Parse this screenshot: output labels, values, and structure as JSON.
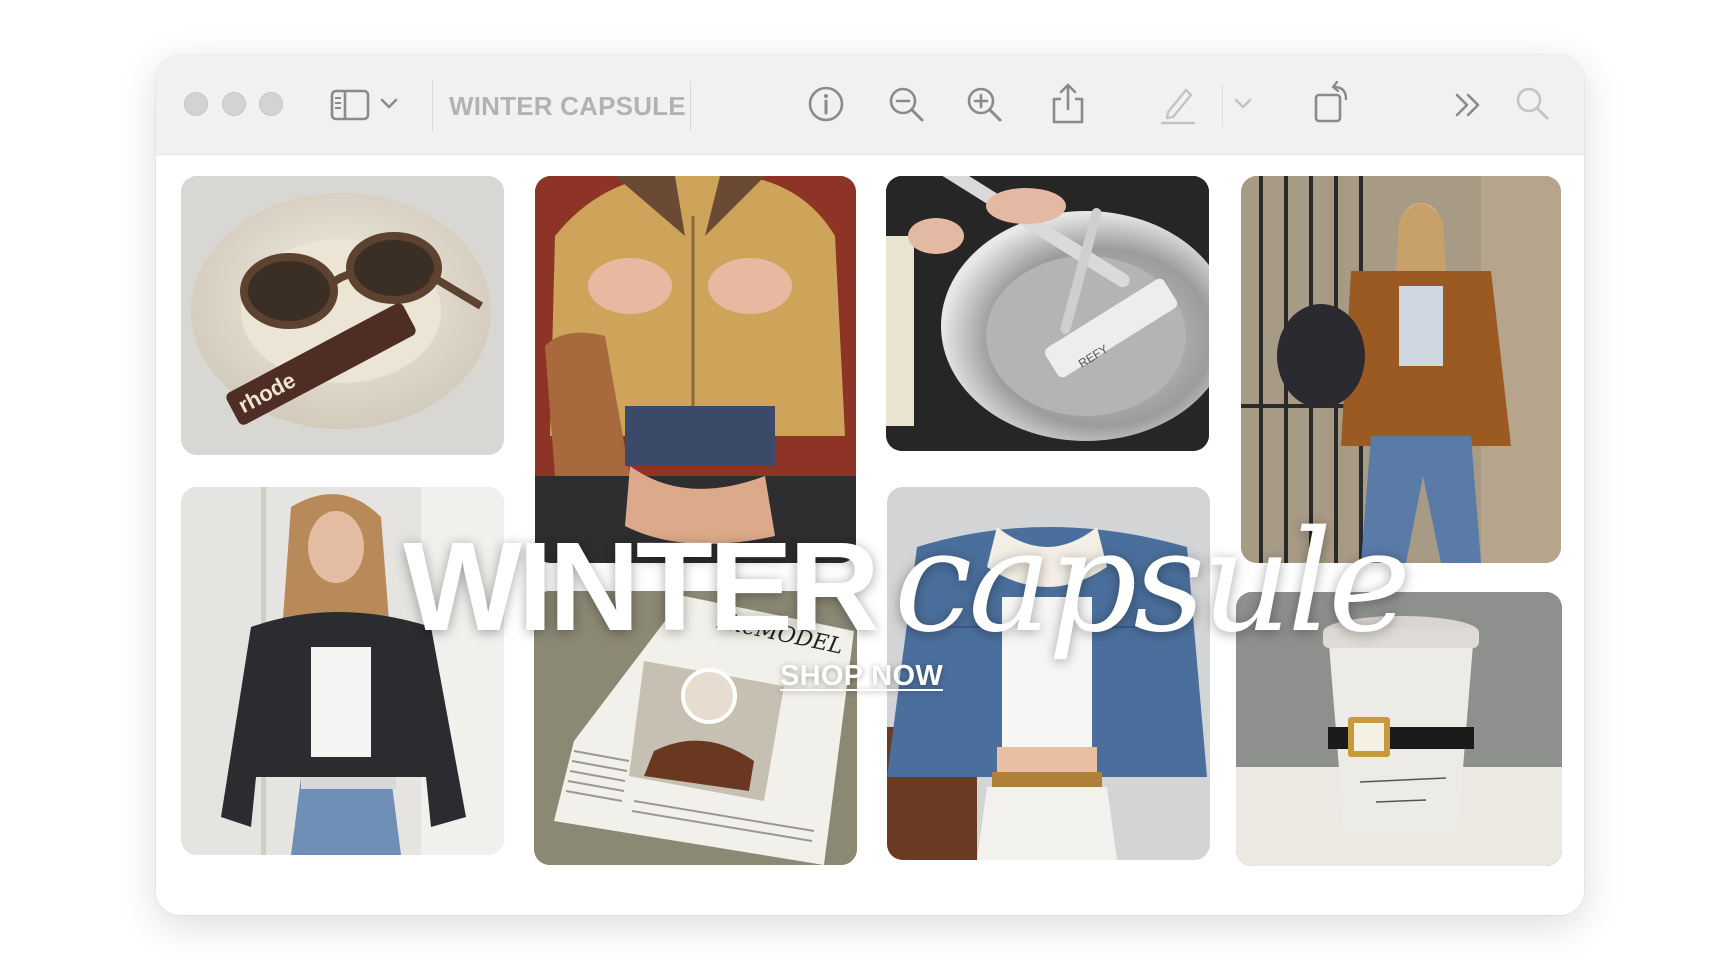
{
  "window": {
    "title": "WINTER CAPSULE",
    "buttons": [
      "close",
      "minimize",
      "zoom"
    ]
  },
  "toolbar": {
    "icons": [
      "sidebar-icon",
      "chevron-down-icon",
      "info-icon",
      "zoom-out-icon",
      "zoom-in-icon",
      "share-icon",
      "markup-pen-icon",
      "chevron-down-icon",
      "rotate-icon",
      "more-icon",
      "search-icon"
    ]
  },
  "hero": {
    "title_caps": "WINTER",
    "title_script": "capsule",
    "cta": "SHOP NOW"
  },
  "tiles": [
    {
      "subject": "sunglasses and rhode tube on ceramic tray",
      "label": "rhode"
    },
    {
      "subject": "mustard corduroy zip jacket"
    },
    {
      "subject": "steel plate with knife, fork and REFY tube",
      "label": "REFY"
    },
    {
      "subject": "woman in brown corduroy jacket and jeans"
    },
    {
      "subject": "woman in black leather jacket"
    },
    {
      "subject": "The MODEL newspaper with coffee cup",
      "label": "TheMODEL"
    },
    {
      "subject": "denim sherpa jacket with white tank"
    },
    {
      "subject": "takeaway coffee cup with gold watch"
    }
  ],
  "colors": {
    "titlebar": "#f1f1f1",
    "toolbar_icon": "#8a8a8a",
    "title_text": "#b2b2b2",
    "overlay_text": "#ffffff"
  }
}
